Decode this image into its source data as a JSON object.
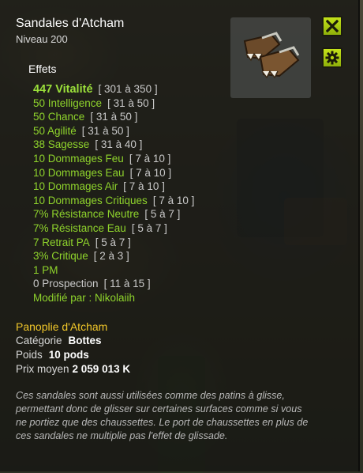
{
  "item": {
    "name": "Sandales d'Atcham",
    "level_label": "Niveau 200",
    "image_icon": "sandals-icon"
  },
  "buttons": {
    "close_icon": "close-icon",
    "settings_icon": "gear-icon",
    "accent_color": "#b5d40f"
  },
  "effects_title": "Effets",
  "effects": [
    {
      "text": "447 Vitalité",
      "range": "[ 301 à 350 ]"
    },
    {
      "text": "50 Intelligence",
      "range": "[ 31 à 50 ]"
    },
    {
      "text": "50 Chance",
      "range": "[ 31 à 50 ]"
    },
    {
      "text": "50 Agilité",
      "range": "[ 31 à 50 ]"
    },
    {
      "text": "38 Sagesse",
      "range": "[ 31 à 40 ]"
    },
    {
      "text": "10 Dommages Feu",
      "range": "[ 7 à 10 ]"
    },
    {
      "text": "10 Dommages Eau",
      "range": "[ 7 à 10 ]"
    },
    {
      "text": "10 Dommages Air",
      "range": "[ 7 à 10 ]"
    },
    {
      "text": "10 Dommages Critiques",
      "range": "[ 7 à 10 ]"
    },
    {
      "text": "7% Résistance Neutre",
      "range": "[ 5 à 7 ]"
    },
    {
      "text": "7% Résistance Eau",
      "range": "[ 5 à 7 ]"
    },
    {
      "text": "7 Retrait PA",
      "range": "[ 5 à 7 ]"
    },
    {
      "text": "3% Critique",
      "range": "[ 2 à 3 ]"
    },
    {
      "text": "1 PM",
      "range": ""
    },
    {
      "text": "0 Prospection",
      "range": "[ 11 à 15 ]"
    }
  ],
  "modified_by": "Modifié par : Nikolaiih",
  "set_name": "Panoplie d'Atcham",
  "info": {
    "category_label": "Catégorie",
    "category_value": "Bottes",
    "weight_label": "Poids",
    "weight_value": "10 pods",
    "price_label": "Prix moyen",
    "price_value": "2 059 013 K"
  },
  "description": "Ces sandales sont aussi utilisées comme des patins à glisse, permettant donc de glisser sur certaines surfaces comme si vous ne portiez que des chaussettes. Le port de chaussettes en plus de ces sandales ne multiplie pas l'effet de glissade."
}
